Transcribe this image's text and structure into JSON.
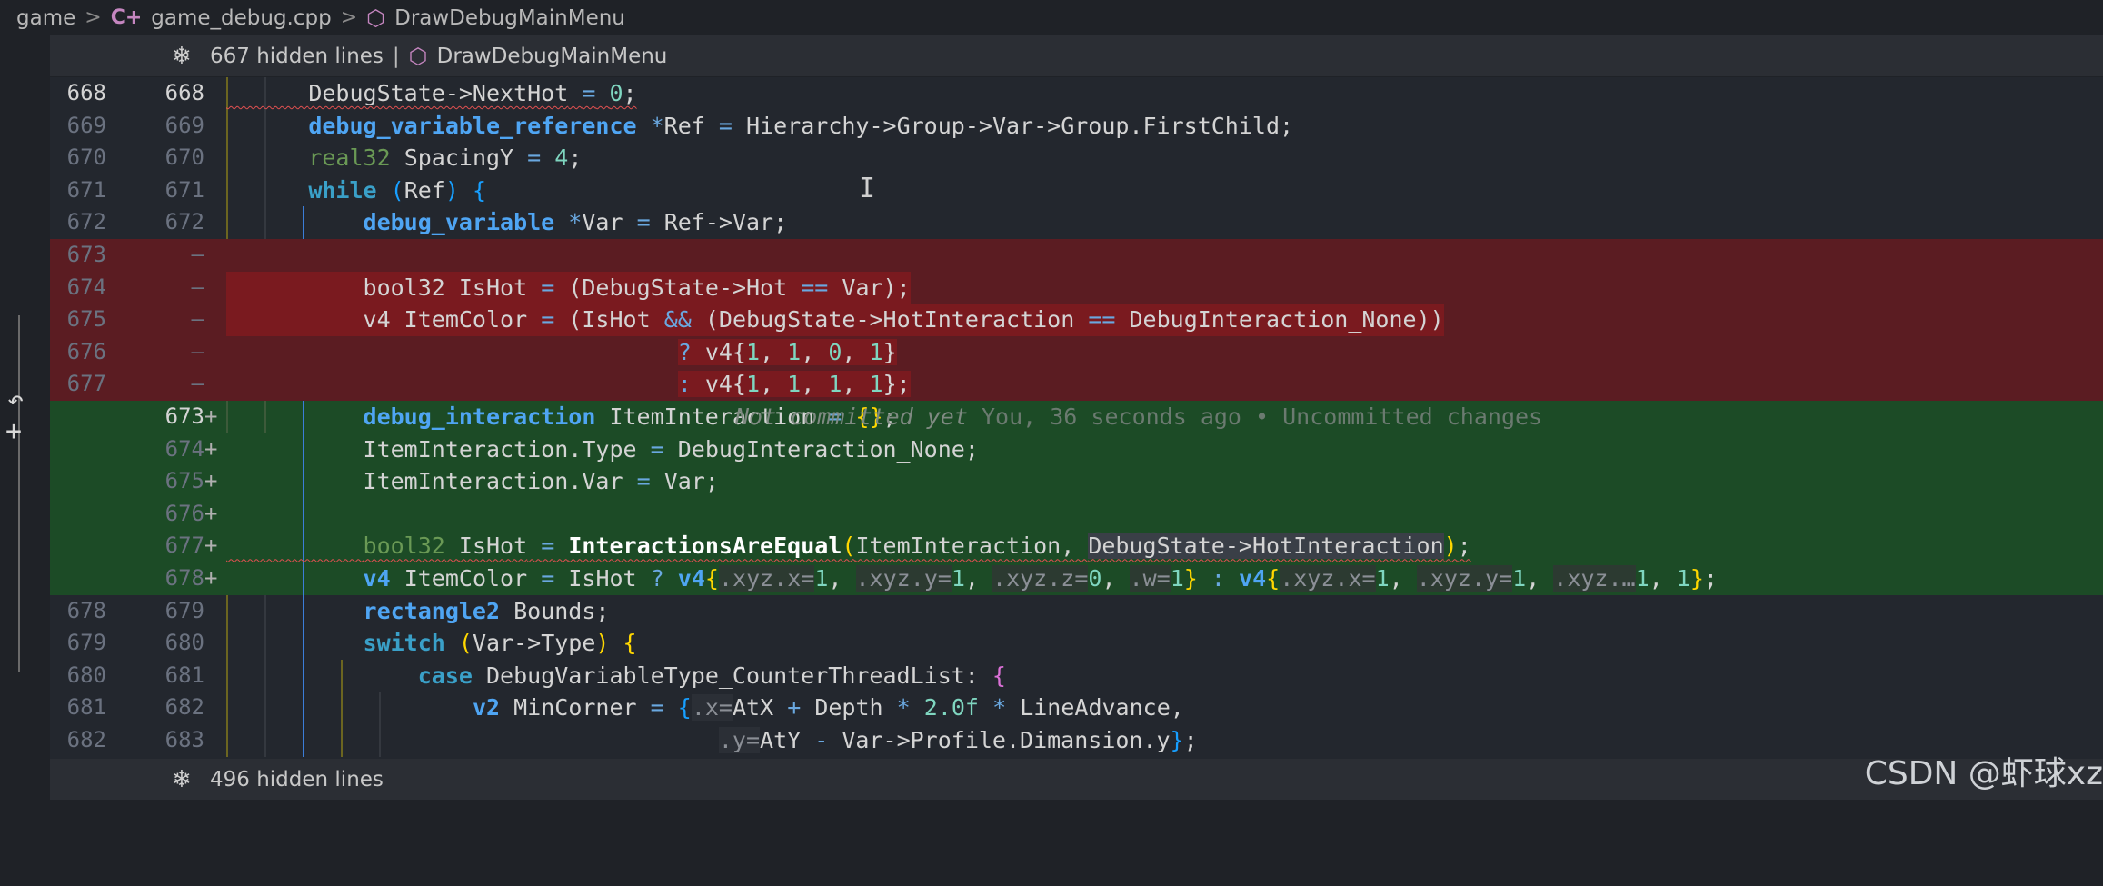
{
  "breadcrumb": {
    "root": "game",
    "file": "game_debug.cpp",
    "file_icon": "cpp-icon",
    "symbol": "DrawDebugMainMenu",
    "symbol_icon": "cube-icon"
  },
  "top_fold": {
    "count_text": "667 hidden lines",
    "separator": "|",
    "symbol": "DrawDebugMainMenu"
  },
  "bottom_fold": {
    "count_text": "496 hidden lines"
  },
  "colors": {
    "deleted": "#5b1c22",
    "added": "#1c4b26",
    "editor_bg": "#23272e"
  },
  "lines": {
    "l0": {
      "n1": "668",
      "n2": "668"
    },
    "l1": {
      "n1": "669",
      "n2": "669"
    },
    "l2": {
      "n1": "670",
      "n2": "670"
    },
    "l3": {
      "n1": "671",
      "n2": "671"
    },
    "l4": {
      "n1": "672",
      "n2": "672"
    },
    "l5": {
      "n1": "673",
      "n2": "",
      "mark": "—"
    },
    "l6": {
      "n1": "674",
      "n2": "",
      "mark": "—"
    },
    "l7": {
      "n1": "675",
      "n2": "",
      "mark": "—"
    },
    "l8": {
      "n1": "676",
      "n2": "",
      "mark": "—"
    },
    "l9": {
      "n1": "677",
      "n2": "",
      "mark": "—"
    },
    "l10": {
      "n1": "",
      "n2": "673",
      "mark": "+"
    },
    "l11": {
      "n1": "",
      "n2": "674",
      "mark": "+"
    },
    "l12": {
      "n1": "",
      "n2": "675",
      "mark": "+"
    },
    "l13": {
      "n1": "",
      "n2": "676",
      "mark": "+"
    },
    "l14": {
      "n1": "",
      "n2": "677",
      "mark": "+"
    },
    "l15": {
      "n1": "",
      "n2": "678",
      "mark": "+"
    },
    "l16": {
      "n1": "678",
      "n2": "679"
    },
    "l17": {
      "n1": "679",
      "n2": "680"
    },
    "l18": {
      "n1": "680",
      "n2": "681"
    },
    "l19": {
      "n1": "681",
      "n2": "682"
    },
    "l20": {
      "n1": "682",
      "n2": "683"
    }
  },
  "blame": {
    "status": "Not committed yet",
    "detail": "You, 36 seconds ago • Uncommitted changes"
  },
  "watermark": "CSDN @虾球xz"
}
